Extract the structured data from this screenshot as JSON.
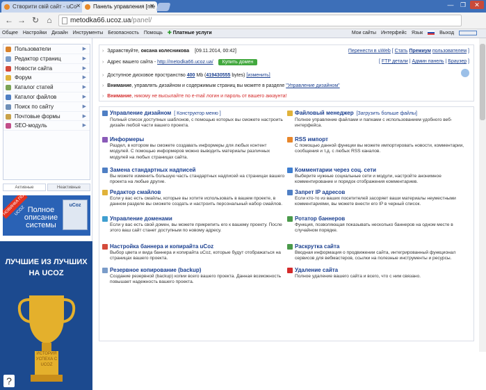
{
  "browser": {
    "tabs": [
      {
        "title": "Створити свій сайт - uCo",
        "active": false
      },
      {
        "title": "Панель управления [me",
        "active": true
      }
    ],
    "url_host": "metodka66.ucoz.ua",
    "url_path": "/panel/",
    "window_controls": [
      "—",
      "❐",
      "✕"
    ]
  },
  "topnav": {
    "left": [
      "Общее",
      "Настройки",
      "Дизайн",
      "Инструменты",
      "Безопасность",
      "Помощь"
    ],
    "premium": "Платные услуги",
    "right": [
      "Мои сайты",
      "Интерфейс",
      "Язык",
      "Выход"
    ]
  },
  "sidebar": {
    "items": [
      {
        "label": "Пользователи",
        "icon": "user-icon",
        "color": "#d9822b"
      },
      {
        "label": "Редактор страниц",
        "icon": "page-icon",
        "color": "#7a9cc9"
      },
      {
        "label": "Новости сайта",
        "icon": "news-icon",
        "color": "#d44a3a"
      },
      {
        "label": "Форум",
        "icon": "forum-icon",
        "color": "#e0b23a"
      },
      {
        "label": "Каталог статей",
        "icon": "articles-icon",
        "color": "#7aa356"
      },
      {
        "label": "Каталог файлов",
        "icon": "files-icon",
        "color": "#4f7fc4"
      },
      {
        "label": "Поиск по сайту",
        "icon": "search-icon",
        "color": "#6f8fb8"
      },
      {
        "label": "Почтовые формы",
        "icon": "mail-icon",
        "color": "#c9a24a"
      },
      {
        "label": "SEO-модуль",
        "icon": "seo-icon",
        "color": "#c24e8a"
      }
    ],
    "tabs": [
      "Активные",
      "Неактивные"
    ],
    "promo": {
      "ribbon": "НОВИНКА ПО UCOZ",
      "text": "Полное описание системы",
      "box": "uCoz"
    },
    "best": {
      "title": "ЛУЧШИЕ ИЗ ЛУЧШИХ НА UCOZ",
      "cup_text": "ИСТОРИЯ УСПЕХА С UCOZ"
    },
    "help": "?"
  },
  "info": {
    "greeting": "Здравствуйте,",
    "user": "оксана колесникова",
    "datetime": "[09.11.2014, 00:42]",
    "address_label": "Адрес вашего сайта -",
    "address": "http://metodka66.ucoz.ua/",
    "buy_domain": "Купить домен",
    "disk": "Доступное дисковое пространство",
    "disk_value": "400",
    "disk_unit": "Mb (",
    "disk_bytes": "419430555",
    "disk_bytes_unit": "bytes)",
    "disk_change": "[изменить]",
    "warn1_label": "Внимание",
    "warn1_text": ", управлять дизайном и содержимым страниц вы можете в разделе",
    "warn1_link": "\"Управление дизайном\"",
    "warn2_label": "Внимание",
    "warn2_text": ", никому не высылайте по e-mail логин и пароль от вашего аккаунта!",
    "right1": "Перенести в uWeb",
    "right1b": "Стать",
    "right1c": "Премиум",
    "right1d": "пользователем",
    "right2": [
      "FTP детали",
      "Админ панель",
      "Браузер"
    ]
  },
  "cards_left": [
    {
      "title": "Управление дизайном",
      "extra": "[ Конструктор меню ]",
      "desc": "Полный список доступных шаблонов, с помощью которых вы сможете настроить дизайн любой части вашего проекта.",
      "icon": "design-icon",
      "color": "#4f7fc4"
    },
    {
      "title": "Информеры",
      "extra": "",
      "desc": "Раздел, в котором вы сможете создавать информеры для любых контент модулей. С помощью информеров можно выводить материалы различных модулей на любых страницах сайта.",
      "icon": "informer-icon",
      "color": "#8a5ab8"
    },
    {
      "title": "Замена стандартных надписей",
      "extra": "",
      "desc": "Вы можете изменить большую часть стандартных надписей на страницах вашего проекта на любые другие.",
      "icon": "replace-icon",
      "color": "#4f7fc4"
    },
    {
      "title": "Редактор смайлов",
      "extra": "",
      "desc": "Если у вас есть смайлы, которые вы хотите использовать в вашем проекте, в данном разделе вы сможете создать и настроить персональный набор смайлов.",
      "icon": "smile-icon",
      "color": "#e0b23a"
    },
    {
      "title": "Управление доменами",
      "extra": "",
      "desc": "Если у вас есть свой домен, вы можете прикрепить его к вашему проекту. После этого ваш сайт станет доступным по новому адресу.",
      "icon": "domain-icon",
      "color": "#3f9fd0"
    },
    {
      "title": "Настройка баннера и копирайта uCoz",
      "extra": "",
      "desc": "Выбор цвета и вида баннера и копирайта uCoz, которые будут отображаться на страницах вашего проекта.",
      "icon": "banner-icon",
      "color": "#d44a3a"
    },
    {
      "title": "Резервное копирование (backup)",
      "extra": "",
      "desc": "Создание резервной (backup) копии всего вашего проекта. Данная возможность повышает надежность вашего проекта.",
      "icon": "backup-icon",
      "color": "#7a9cc9"
    }
  ],
  "cards_right": [
    {
      "title": "Файловый менеджер",
      "extra": "[Загрузить больше файлы]",
      "desc": "Полное управление файлами и папками с использованием удобного веб-интерфейса.",
      "icon": "folder-icon",
      "color": "#e0b23a"
    },
    {
      "title": "RSS импорт",
      "extra": "",
      "desc": "С помощью данной функции вы можете импортировать новости, комментарии, сообщения и т.д. с любых RSS каналов.",
      "icon": "rss-icon",
      "color": "#e8862a"
    },
    {
      "title": "Комментарии через соц. сети",
      "extra": "",
      "desc": "Выберите нужные социальные сети и модули, настройте анонимное комментирование и порядок отображения комментариев.",
      "icon": "comments-icon",
      "color": "#3f7fd0"
    },
    {
      "title": "Запрет IP адресов",
      "extra": "",
      "desc": "Если кто-то из ваших посетителей засоряет ваши материалы неуместными комментариями, вы можете внести его IP в черный список.",
      "icon": "ipban-icon",
      "color": "#4f7fc4"
    },
    {
      "title": "Ротатор баннеров",
      "extra": "",
      "desc": "Функция, позволяющая показывать несколько баннеров на одном месте в случайном порядке.",
      "icon": "rotator-icon",
      "color": "#4a9a4a"
    },
    {
      "title": "Раскрутка сайта",
      "extra": "",
      "desc": "Вводная информация о продвижении сайта, интегрированный функционал сервисов для вебмастеров, ссылки на полезные инструменты и ресурсы.",
      "icon": "promo-icon",
      "color": "#4a9a4a"
    },
    {
      "title": "Удаление сайта",
      "extra": "",
      "desc": "Полное удаление вашего сайта и всего, что с ним связано.",
      "icon": "delete-icon",
      "color": "#d42a2a"
    }
  ]
}
